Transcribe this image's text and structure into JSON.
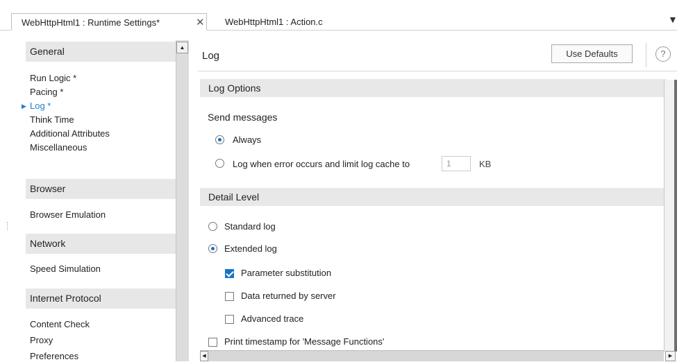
{
  "tabs": {
    "active_label": "WebHttpHtml1 : Runtime Settings*",
    "close_glyph": "✕",
    "inactive_label": "WebHttpHtml1 : Action.c",
    "menu_glyph": "▼"
  },
  "sidebar": {
    "groups": [
      {
        "header": "General",
        "items": [
          "Run Logic *",
          "Pacing *",
          "Log *",
          "Think Time",
          "Additional Attributes",
          "Miscellaneous"
        ]
      },
      {
        "header": "Browser",
        "items": [
          "Browser Emulation"
        ]
      },
      {
        "header": "Network",
        "items": [
          "Speed Simulation"
        ]
      },
      {
        "header": "Internet Protocol",
        "items": [
          "Content Check",
          "Proxy",
          "Preferences"
        ]
      }
    ],
    "selected_item": "Log *",
    "selected_marker": "▶"
  },
  "main": {
    "title": "Log",
    "use_defaults_label": "Use Defaults",
    "help_glyph": "?",
    "log_options": {
      "header": "Log Options",
      "send_messages_label": "Send messages",
      "always_label": "Always",
      "always_selected": true,
      "on_error_label": "Log when error occurs and limit log cache to",
      "on_error_selected": false,
      "cache_value": "1",
      "cache_unit": "KB"
    },
    "detail_level": {
      "header": "Detail Level",
      "standard_label": "Standard log",
      "standard_selected": false,
      "extended_label": "Extended log",
      "extended_selected": true,
      "param_sub_label": "Parameter substitution",
      "param_sub_checked": true,
      "data_returned_label": "Data returned by server",
      "data_returned_checked": false,
      "advanced_trace_label": "Advanced trace",
      "advanced_trace_checked": false,
      "print_timestamp_label": "Print timestamp for 'Message Functions'",
      "print_timestamp_checked": false
    }
  },
  "colors": {
    "accent": "#1f7fd1",
    "section_bg": "#e8e8e8"
  }
}
